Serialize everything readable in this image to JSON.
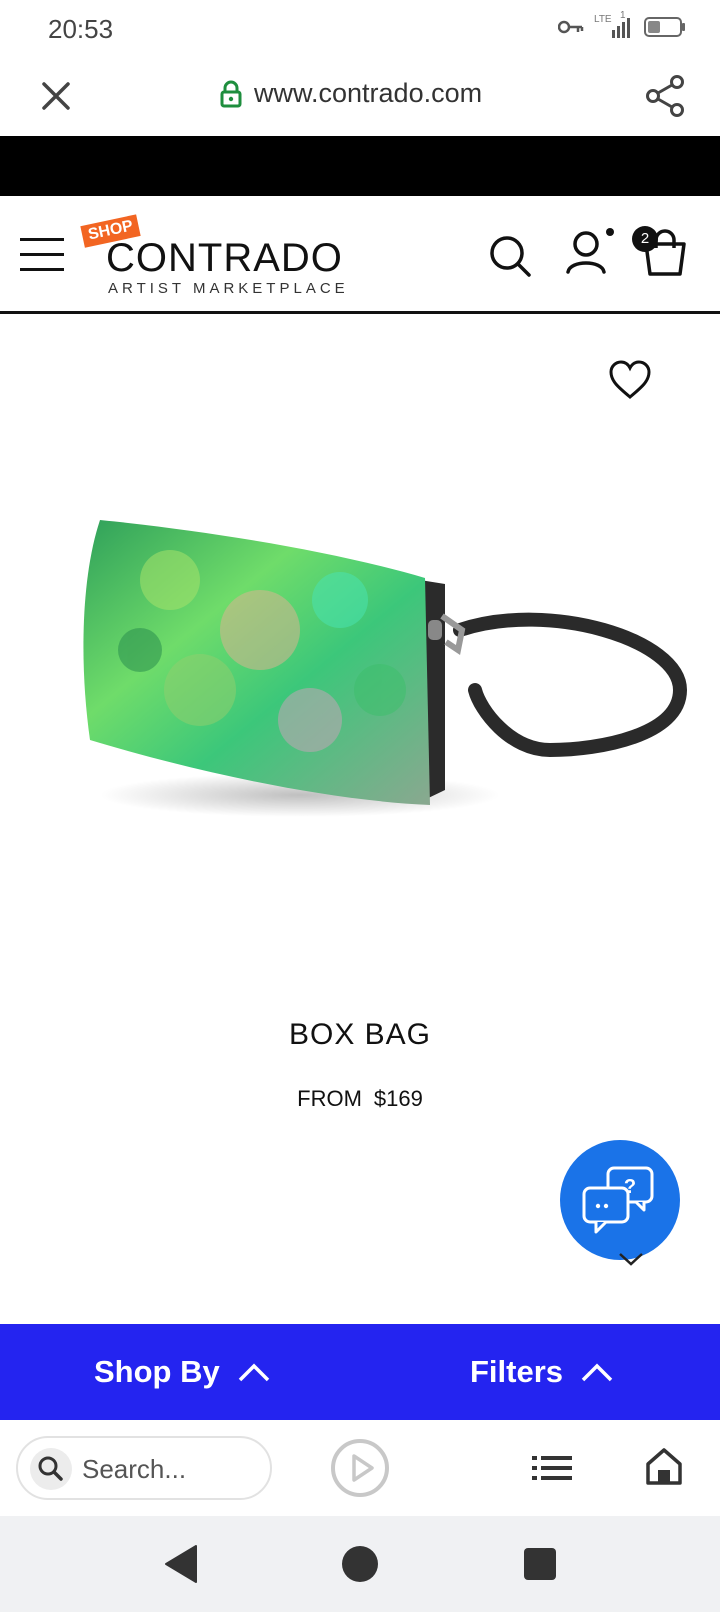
{
  "status_bar": {
    "time": "20:53",
    "network_label": "LTE",
    "sim_slot": "1",
    "icons": [
      "vpn-key-icon",
      "signal-icon",
      "battery-icon"
    ]
  },
  "browser": {
    "url": "www.contrado.com",
    "icons": [
      "close-icon",
      "lock-icon",
      "share-icon"
    ]
  },
  "header": {
    "logo_badge": "SHOP",
    "logo_name": "CONTRADO",
    "logo_tagline": "ARTIST MARKETPLACE",
    "cart_count": "2",
    "icons": [
      "menu-icon",
      "search-icon",
      "account-icon",
      "cart-icon"
    ]
  },
  "product": {
    "name": "BOX BAG",
    "price_prefix": "FROM",
    "price": "$169"
  },
  "filter_bar": {
    "shop_by_label": "Shop By",
    "filters_label": "Filters"
  },
  "bottom_toolbar": {
    "search_placeholder": "Search..."
  },
  "colors": {
    "filter_bar_bg": "#2424f0",
    "chat_fab_bg": "#1a73e8",
    "logo_badge_bg": "#f26522",
    "lock_green": "#1e8e3e"
  }
}
